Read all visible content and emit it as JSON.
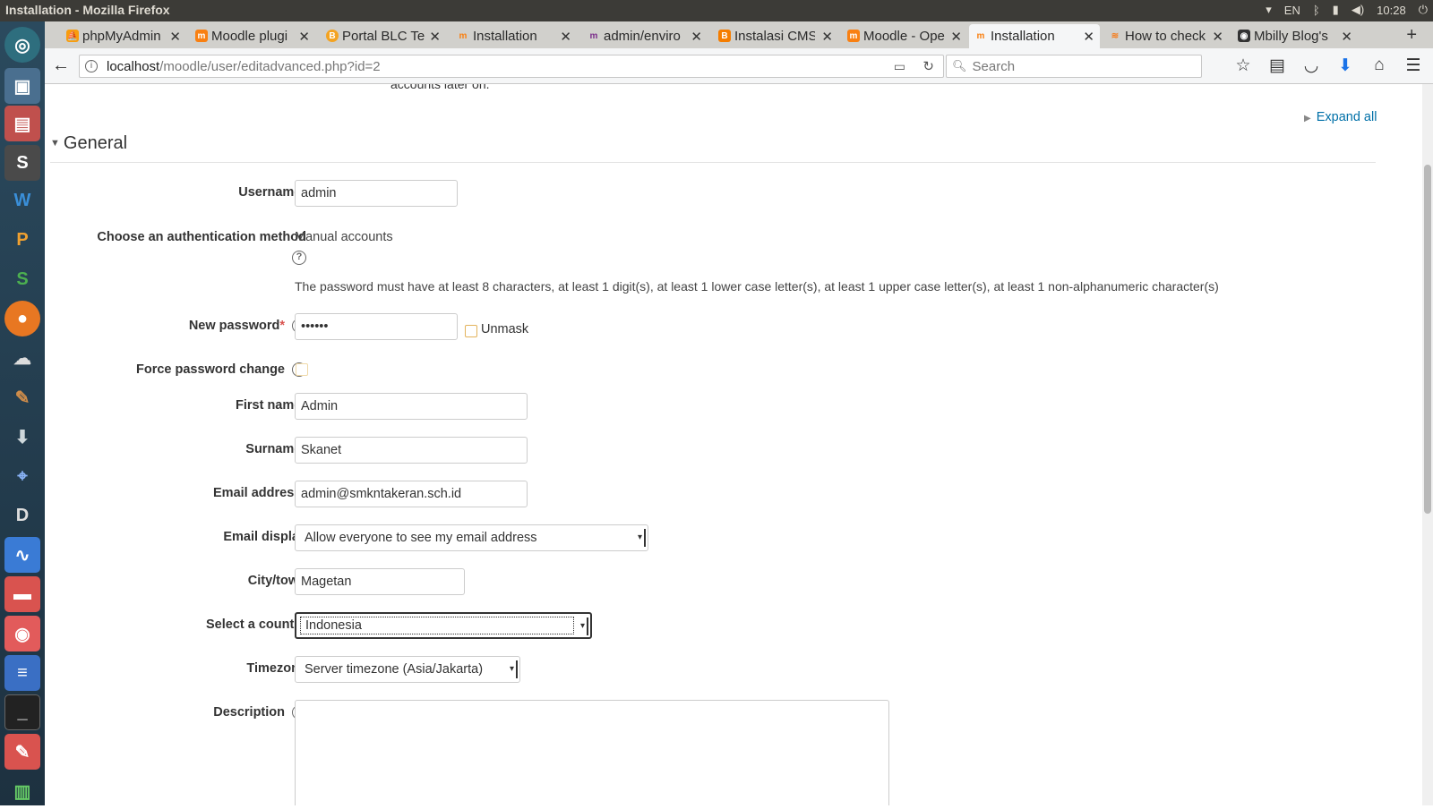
{
  "window": {
    "title": "Installation - Mozilla Firefox",
    "tray": {
      "lang": "EN",
      "time": "10:28"
    }
  },
  "launcher": [
    "dash",
    "camera",
    "files",
    "sublime",
    "writer",
    "pdf",
    "sheets",
    "firefox",
    "cloud",
    "paint",
    "installer",
    "maps",
    "documents",
    "monitor",
    "screenshot",
    "viewer",
    "text-editor",
    "terminal",
    "draw",
    "trash"
  ],
  "tabs": [
    {
      "label": "phpMyAdmin",
      "favicon": "phpmyadmin-icon",
      "color": "#f89c0e"
    },
    {
      "label": "Moodle plugi",
      "favicon": "moodle-icon",
      "color": "#f98012"
    },
    {
      "label": "Portal BLC Te",
      "favicon": "blc-icon",
      "color": "#f4a321"
    },
    {
      "label": "Installation",
      "favicon": "moodle-m-icon",
      "color": "#f98012"
    },
    {
      "label": "admin/enviro",
      "favicon": "moodle-m-icon",
      "color": "#7b2d8b"
    },
    {
      "label": "Instalasi CMS",
      "favicon": "blogger-icon",
      "color": "#f57d00"
    },
    {
      "label": "Moodle - Ope",
      "favicon": "moodle-icon",
      "color": "#f98012"
    },
    {
      "label": "Installation",
      "favicon": "moodle-m-icon",
      "color": "#f98012",
      "active": true
    },
    {
      "label": "How to check",
      "favicon": "stackoverflow-icon",
      "color": "#f48024"
    },
    {
      "label": "Mbilly Blog's",
      "favicon": "blog-icon",
      "color": "#333"
    }
  ],
  "urlbar": {
    "host": "localhost",
    "path": "/moodle/user/editadvanced.php?id=2",
    "search_placeholder": "Search"
  },
  "page": {
    "cut_text": "accounts later on.",
    "expand_all": "Expand all",
    "section_title": "General",
    "fields": {
      "username": {
        "label": "Username",
        "value": "admin"
      },
      "auth": {
        "label": "Choose an authentication method",
        "value": "Manual accounts"
      },
      "password_rules": "The password must have at least 8 characters, at least 1 digit(s), at least 1 lower case letter(s), at least 1 upper case letter(s), at least 1 non-alphanumeric character(s)",
      "new_password": {
        "label": "New password",
        "value": "••••••",
        "unmask": "Unmask"
      },
      "force_change": {
        "label": "Force password change"
      },
      "first_name": {
        "label": "First name",
        "value": "Admin"
      },
      "surname": {
        "label": "Surname",
        "value": "Skanet"
      },
      "email": {
        "label": "Email address",
        "value": "admin@smkntakeran.sch.id"
      },
      "email_display": {
        "label": "Email display",
        "value": "Allow everyone to see my email address"
      },
      "city": {
        "label": "City/town",
        "value": "Magetan"
      },
      "country": {
        "label": "Select a country",
        "value": "Indonesia"
      },
      "timezone": {
        "label": "Timezone",
        "value": "Server timezone (Asia/Jakarta)"
      },
      "description": {
        "label": "Description"
      }
    },
    "required_marker": "*"
  }
}
